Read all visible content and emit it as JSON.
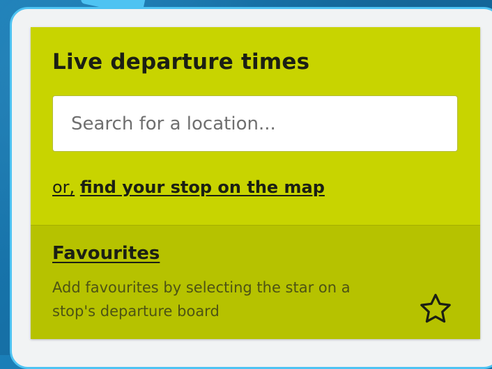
{
  "live": {
    "title": "Live departure times",
    "search_placeholder": "Search for a location...",
    "or_text": "or,",
    "map_link_text": "find your stop on the map"
  },
  "favourites": {
    "title": "Favourites",
    "description": "Add favourites by selecting the star on a stop's departure board",
    "icon": "star-icon"
  },
  "colors": {
    "card_green": "#c8d400",
    "favourites_green": "#b6c200",
    "frame_accent": "#4ec3f2",
    "background_blue": "#1670a6"
  }
}
